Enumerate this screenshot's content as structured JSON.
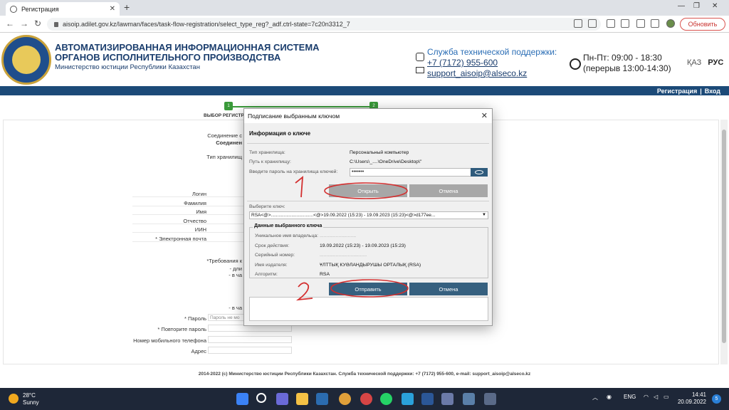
{
  "browser": {
    "tab_title": "Регистрация",
    "tab_close": "✕",
    "new_tab": "+",
    "url": "aisoip.adilet.gov.kz/lawman/faces/task-flow-registration/select_type_reg?_adf.ctrl-state=7c20n3312_7",
    "update_label": "Обновить",
    "back": "←",
    "forward": "→",
    "reload": "↻"
  },
  "site": {
    "title_line1": "АВТОМАТИЗИРОВАННАЯ ИНФОРМАЦИОННАЯ СИСТЕМА",
    "title_line2": "ОРГАНОВ ИСПОЛНИТЕЛЬНОГО ПРОИЗВОДСТВА",
    "subtitle": "Министерство юстиции Республики Казахстан",
    "support_title": "Служба технической поддержки:",
    "support_phone": "+7 (7172) 955-600",
    "support_email": "support_aisoip@alseco.kz",
    "hours_line1": "Пн-Пт: 09:00 - 18:30",
    "hours_line2": "(перерыв 13:00-14:30)",
    "lang_kz": "ҚАЗ",
    "lang_ru": "РУС",
    "nav_register": "Регистрация",
    "nav_sep": "|",
    "nav_login": "Вход"
  },
  "page": {
    "step1": "1",
    "step2": "2",
    "step_label": "ВЫБОР РЕГИСТРА",
    "label_connection": "Соединение с",
    "label_connection_bold": "Соединен",
    "label_storage": "Тип хранилищ",
    "label_login": "Логин",
    "label_lastname": "Фамилия",
    "label_firstname": "Имя",
    "label_patronymic": "Отчество",
    "label_iin": "ИИН",
    "label_email": "* Электронная почта",
    "req_title": "*Требования к",
    "req_item1": "- дли",
    "req_item2": "- в ча",
    "req_item3": "- в ча",
    "label_password": "* Пароль",
    "password_placeholder": "Пароль не мо",
    "label_repeat_password": "* Повторите пароль",
    "label_phone": "Номер мобильного телефона",
    "label_address": "Адрес",
    "footer": "2014-2022 (с) Министерство юстиции Республики Казахстан. Служба технической поддержки: +7 (7172) 955-600, e-mail: support_aisoip@alseco.kz"
  },
  "dialog": {
    "title": "Подписание выбранным ключом",
    "close": "✕",
    "info_header": "Информация о ключе",
    "storage_type_label": "Тип хранилища:",
    "storage_type_value": "Персональный компьютер",
    "storage_path_label": "Путь к хранилищу:",
    "storage_path_value": "C:\\Users\\_....\\OneDrive\\Desktop\\\"",
    "password_label": "Введите пароль на хранилища ключей:",
    "password_value": "•••••••",
    "open_button": "Открыть",
    "cancel_button_1": "Отмена",
    "select_key_label": "Выберите ключ:",
    "selected_key": "RSA<@>.................................<@>19.09.2022 (15:23) - 19.09.2023 (15:23)<@>d177ee...",
    "key_group_title": "Данные выбранного ключа",
    "owner_label": "Уникальное имя владельца:",
    "owner_value": "...........................",
    "validity_label": "Срок действия:",
    "validity_value": "19.09.2022 (15:23) - 19.09.2023 (15:23)",
    "serial_label": "Серийный номер:",
    "serial_value": "...................................",
    "issuer_label": "Имя издателя:",
    "issuer_value": "ҰЛТТЫҚ КУӘЛАНДЫРУШЫ ОРТАЛЫҚ (RSA)",
    "algorithm_label": "Алгоритм:",
    "algorithm_value": "RSA",
    "send_button": "Отправить",
    "cancel_button_2": "Отмена"
  },
  "taskbar": {
    "temperature": "28°C",
    "weather": "Sunny",
    "lang": "ENG",
    "time": "14:41",
    "date": "20.09.2022",
    "notifications": "5"
  }
}
